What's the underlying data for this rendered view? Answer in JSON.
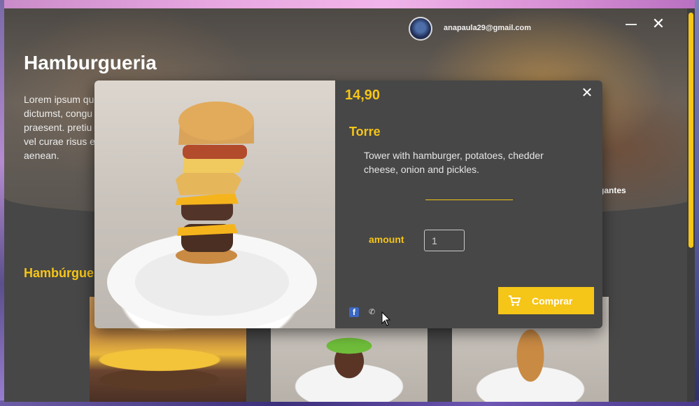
{
  "app": {
    "title": "Hamburgueria",
    "description": "Lorem ipsum qu\ndictumst, congu\npraesent. pretiu\nvel curae risus e\naenean.",
    "hero_right_text": "gantes",
    "user_email": "anapaula29@gmail.com",
    "close_glyph": "✕",
    "section_heading": "Hambúrgue"
  },
  "modal": {
    "price": "14,90",
    "name": "Torre",
    "description": "Tower with hamburger, potatoes, chedder cheese, onion and pickles.",
    "amount_label": "amount",
    "amount_value": "1",
    "buy_label": "Comprar",
    "close_glyph": "✕",
    "share_facebook": "f",
    "share_phone": "✆"
  },
  "colors": {
    "accent": "#f5c518",
    "panel": "#474747",
    "text": "#ffffff"
  }
}
